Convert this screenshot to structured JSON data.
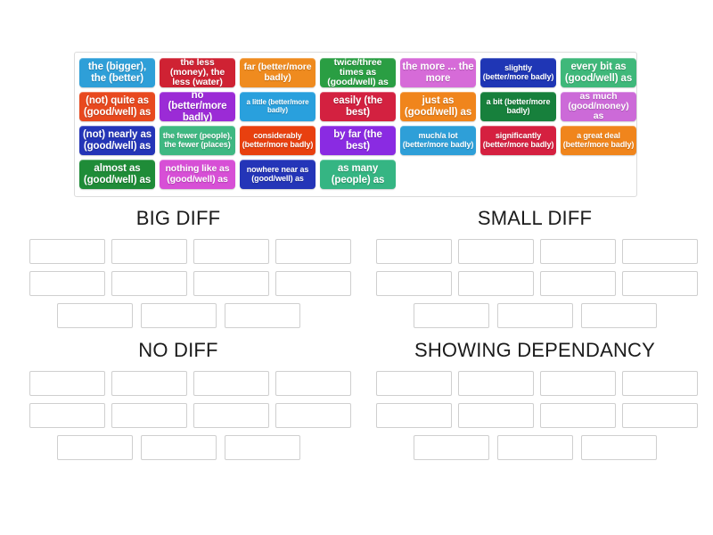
{
  "activity": {
    "type": "group-sort-drag-and-drop"
  },
  "tile_tray": {
    "name": "word-bank",
    "rows": [
      [
        {
          "text": "the (bigger), the (better)",
          "color": "#2e9fd8",
          "size": "sz-lg"
        },
        {
          "text": "the less (money), the less (water)",
          "color": "#cf2233",
          "size": "sz-md"
        },
        {
          "text": "far (better/more badly)",
          "color": "#ef8b1f",
          "size": "sz-md"
        },
        {
          "text": "twice/three times as (good/well) as",
          "color": "#2a9e43",
          "size": "sz-md"
        },
        {
          "text": "the more ... the more",
          "color": "#d66bd8",
          "size": "sz-lg"
        },
        {
          "text": "slightly (better/more badly)",
          "color": "#1f36b5",
          "size": "sz-sm"
        },
        {
          "text": "every bit as (good/well) as",
          "color": "#3fb87a",
          "size": "sz-lg"
        }
      ],
      [
        {
          "text": "(not) quite as (good/well) as",
          "color": "#e8491f",
          "size": "sz-lg"
        },
        {
          "text": "no (better/more badly)",
          "color": "#9b2bd6",
          "size": "sz-lg"
        },
        {
          "text": "a little (better/more badly)",
          "color": "#29a0dd",
          "size": "sz-xs"
        },
        {
          "text": "easily (the best)",
          "color": "#d32140",
          "size": "sz-lg"
        },
        {
          "text": "just as (good/well) as",
          "color": "#f0851c",
          "size": "sz-lg"
        },
        {
          "text": "a bit (better/more badly)",
          "color": "#17803c",
          "size": "sz-sm"
        },
        {
          "text": "as much (good/money) as",
          "color": "#cc6ad8",
          "size": "sz-md"
        }
      ],
      [
        {
          "text": "(not) nearly as (good/well) as",
          "color": "#2435b8",
          "size": "sz-lg"
        },
        {
          "text": "the fewer (people), the fewer (places)",
          "color": "#3fb882",
          "size": "sz-sm"
        },
        {
          "text": "considerably (better/more badly)",
          "color": "#e8400f",
          "size": "sz-sm"
        },
        {
          "text": "by far (the best)",
          "color": "#8a2be2",
          "size": "sz-lg"
        },
        {
          "text": "much/a lot (better/more badly)",
          "color": "#2e9fd8",
          "size": "sz-sm"
        },
        {
          "text": "significantly (better/more badly)",
          "color": "#d52040",
          "size": "sz-sm"
        },
        {
          "text": "a great deal (better/more badly)",
          "color": "#f0851c",
          "size": "sz-sm"
        }
      ],
      [
        {
          "text": "almost as (good/well) as",
          "color": "#1f8c38",
          "size": "sz-lg"
        },
        {
          "text": "nothing like as (good/well) as",
          "color": "#d74fd6",
          "size": "sz-md"
        },
        {
          "text": "nowhere near as (good/well) as",
          "color": "#2435b8",
          "size": "sz-sm"
        },
        {
          "text": "as many (people) as",
          "color": "#35b583",
          "size": "sz-lg"
        }
      ]
    ]
  },
  "categories": [
    {
      "title": "BIG DIFF",
      "slot_rows": [
        4,
        4,
        3
      ]
    },
    {
      "title": "SMALL DIFF",
      "slot_rows": [
        4,
        4,
        3
      ]
    },
    {
      "title": "NO DIFF",
      "slot_rows": [
        4,
        4,
        3
      ]
    },
    {
      "title": "SHOWING DEPENDANCY",
      "slot_rows": [
        4,
        4,
        3
      ]
    }
  ]
}
